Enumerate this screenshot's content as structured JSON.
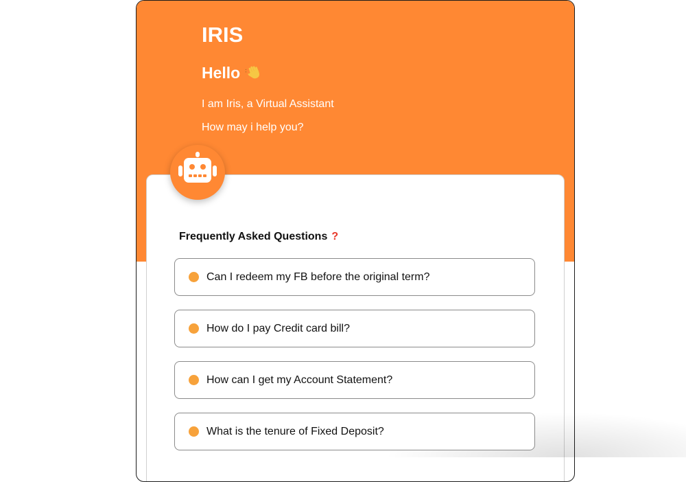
{
  "header": {
    "title": "IRIS",
    "greeting": "Hello",
    "greeting_icon": "waving-hand-icon",
    "intro_line_1": "I am Iris, a Virtual Assistant",
    "intro_line_2": "How may i help you?"
  },
  "avatar": {
    "icon": "robot-icon"
  },
  "faq": {
    "heading": "Frequently Asked Questions",
    "heading_icon": "question-mark-icon",
    "heading_mark": "?",
    "items": [
      {
        "label": "Can I redeem my FB before the original term?"
      },
      {
        "label": "How do I pay Credit card bill?"
      },
      {
        "label": "How can I get my Account Statement?"
      },
      {
        "label": "What is the tenure of Fixed Deposit?"
      }
    ]
  },
  "colors": {
    "brand_orange": "#ff8833",
    "bullet_orange": "#f7a23b",
    "question_mark_red": "#e8382a"
  }
}
